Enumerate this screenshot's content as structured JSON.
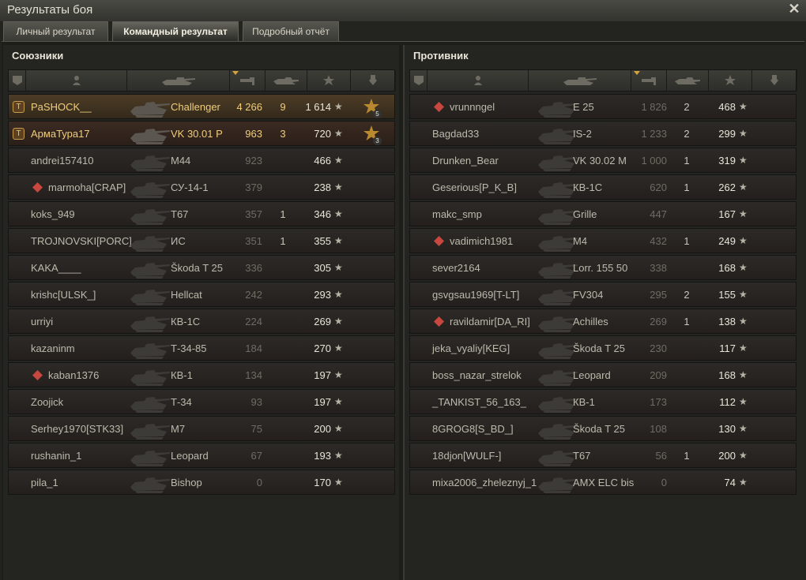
{
  "window": {
    "title": "Результаты боя",
    "close_glyph": "✕"
  },
  "tabs": [
    {
      "label": "Личный результат",
      "active": false
    },
    {
      "label": "Командный результат",
      "active": true
    },
    {
      "label": "Подробный отчёт",
      "active": false
    }
  ],
  "header_icons": [
    "platoon-icon",
    "player-icon",
    "tank-icon",
    "damage-icon",
    "kills-icon",
    "xp-star-icon",
    "medal-icon"
  ],
  "colors": {
    "accent": "#f0cd7c",
    "sort_arrow": "#d4a33c",
    "badge": "#c59a52"
  },
  "star_glyph": "★",
  "allies": {
    "title": "Союзники",
    "rows": [
      {
        "name": "PaSHOCK__",
        "tank": "Challenger",
        "damage": "4 266",
        "kills": "9",
        "xp": "1 614",
        "highlight": "self",
        "badge": true,
        "sq": false,
        "medal": "5"
      },
      {
        "name": "АрмаТура17",
        "tank": "VK 30.01 P",
        "damage": "963",
        "kills": "3",
        "xp": "720",
        "highlight": "platoon",
        "badge": true,
        "sq": false,
        "medal": "3"
      },
      {
        "name": "andrei157410",
        "tank": "M44",
        "damage": "923",
        "kills": "",
        "xp": "466",
        "highlight": "",
        "badge": false,
        "sq": false,
        "medal": ""
      },
      {
        "name": "marmoha[CRAP]",
        "tank": "СУ-14-1",
        "damage": "379",
        "kills": "",
        "xp": "238",
        "highlight": "",
        "badge": false,
        "sq": true,
        "medal": ""
      },
      {
        "name": "koks_949",
        "tank": "T67",
        "damage": "357",
        "kills": "1",
        "xp": "346",
        "highlight": "",
        "badge": false,
        "sq": false,
        "medal": ""
      },
      {
        "name": "TROJNOVSKI[PORC]",
        "tank": "ИС",
        "damage": "351",
        "kills": "1",
        "xp": "355",
        "highlight": "",
        "badge": false,
        "sq": false,
        "medal": ""
      },
      {
        "name": "KAKA____",
        "tank": "Škoda T 25",
        "damage": "336",
        "kills": "",
        "xp": "305",
        "highlight": "",
        "badge": false,
        "sq": false,
        "medal": ""
      },
      {
        "name": "krishc[ULSK_]",
        "tank": "Hellcat",
        "damage": "242",
        "kills": "",
        "xp": "293",
        "highlight": "",
        "badge": false,
        "sq": false,
        "medal": ""
      },
      {
        "name": "urriyi",
        "tank": "КВ-1С",
        "damage": "224",
        "kills": "",
        "xp": "269",
        "highlight": "",
        "badge": false,
        "sq": false,
        "medal": ""
      },
      {
        "name": "kazaninm",
        "tank": "Т-34-85",
        "damage": "184",
        "kills": "",
        "xp": "270",
        "highlight": "",
        "badge": false,
        "sq": false,
        "medal": ""
      },
      {
        "name": "kaban1376",
        "tank": "КВ-1",
        "damage": "134",
        "kills": "",
        "xp": "197",
        "highlight": "",
        "badge": false,
        "sq": true,
        "medal": ""
      },
      {
        "name": "Zoojick",
        "tank": "Т-34",
        "damage": "93",
        "kills": "",
        "xp": "197",
        "highlight": "",
        "badge": false,
        "sq": false,
        "medal": ""
      },
      {
        "name": "Serhey1970[STK33]",
        "tank": "M7",
        "damage": "75",
        "kills": "",
        "xp": "200",
        "highlight": "",
        "badge": false,
        "sq": false,
        "medal": ""
      },
      {
        "name": "rushanin_1",
        "tank": "Leopard",
        "damage": "67",
        "kills": "",
        "xp": "193",
        "highlight": "",
        "badge": false,
        "sq": false,
        "medal": ""
      },
      {
        "name": "pila_1",
        "tank": "Bishop",
        "damage": "0",
        "kills": "",
        "xp": "170",
        "highlight": "",
        "badge": false,
        "sq": false,
        "medal": ""
      }
    ]
  },
  "enemies": {
    "title": "Противник",
    "rows": [
      {
        "name": "vrunnngel",
        "tank": "E 25",
        "damage": "1 826",
        "kills": "2",
        "xp": "468",
        "highlight": "",
        "badge": false,
        "sq": true,
        "medal": ""
      },
      {
        "name": "Bagdad33",
        "tank": "IS-2",
        "damage": "1 233",
        "kills": "2",
        "xp": "299",
        "highlight": "",
        "badge": false,
        "sq": false,
        "medal": ""
      },
      {
        "name": "Drunken_Bear",
        "tank": "VK 30.02 M",
        "damage": "1 000",
        "kills": "1",
        "xp": "319",
        "highlight": "",
        "badge": false,
        "sq": false,
        "medal": ""
      },
      {
        "name": "Geserious[P_K_B]",
        "tank": "КВ-1С",
        "damage": "620",
        "kills": "1",
        "xp": "262",
        "highlight": "",
        "badge": false,
        "sq": false,
        "medal": ""
      },
      {
        "name": "makc_smp",
        "tank": "Grille",
        "damage": "447",
        "kills": "",
        "xp": "167",
        "highlight": "",
        "badge": false,
        "sq": false,
        "medal": ""
      },
      {
        "name": "vadimich1981",
        "tank": "M4",
        "damage": "432",
        "kills": "1",
        "xp": "249",
        "highlight": "",
        "badge": false,
        "sq": true,
        "medal": ""
      },
      {
        "name": "sever2164",
        "tank": "Lorr. 155 50",
        "damage": "338",
        "kills": "",
        "xp": "168",
        "highlight": "",
        "badge": false,
        "sq": false,
        "medal": ""
      },
      {
        "name": "gsvgsau1969[T-LT]",
        "tank": "FV304",
        "damage": "295",
        "kills": "2",
        "xp": "155",
        "highlight": "",
        "badge": false,
        "sq": false,
        "medal": ""
      },
      {
        "name": "ravildamir[DA_RI]",
        "tank": "Achilles",
        "damage": "269",
        "kills": "1",
        "xp": "138",
        "highlight": "",
        "badge": false,
        "sq": true,
        "medal": ""
      },
      {
        "name": "jeka_vyaliy[KEG]",
        "tank": "Škoda T 25",
        "damage": "230",
        "kills": "",
        "xp": "117",
        "highlight": "",
        "badge": false,
        "sq": false,
        "medal": ""
      },
      {
        "name": "boss_nazar_strelok",
        "tank": "Leopard",
        "damage": "209",
        "kills": "",
        "xp": "168",
        "highlight": "",
        "badge": false,
        "sq": false,
        "medal": ""
      },
      {
        "name": "_TANKIST_56_163_",
        "tank": "КВ-1",
        "damage": "173",
        "kills": "",
        "xp": "112",
        "highlight": "",
        "badge": false,
        "sq": false,
        "medal": ""
      },
      {
        "name": "8GROG8[S_BD_]",
        "tank": "Škoda T 25",
        "damage": "108",
        "kills": "",
        "xp": "130",
        "highlight": "",
        "badge": false,
        "sq": false,
        "medal": ""
      },
      {
        "name": "18djon[WULF-]",
        "tank": "T67",
        "damage": "56",
        "kills": "1",
        "xp": "200",
        "highlight": "",
        "badge": false,
        "sq": false,
        "medal": ""
      },
      {
        "name": "mixa2006_zheleznyj_1",
        "tank": "AMX ELC bis",
        "damage": "0",
        "kills": "",
        "xp": "74",
        "highlight": "",
        "badge": false,
        "sq": false,
        "medal": ""
      }
    ]
  }
}
